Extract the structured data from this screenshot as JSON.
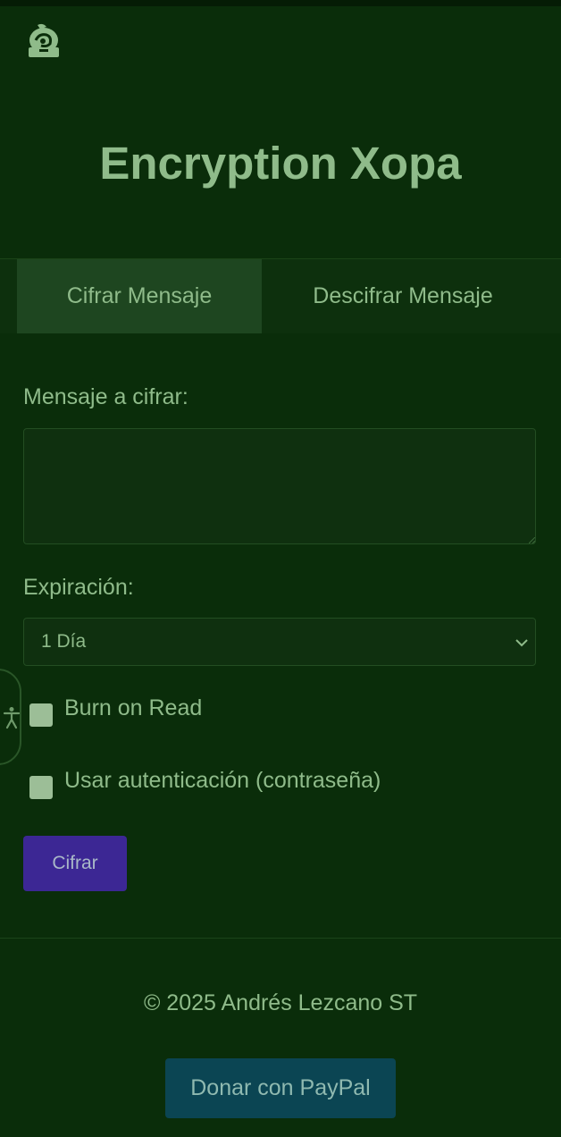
{
  "header": {
    "logo_icon": "leaf-lock-logo-icon",
    "title": "Encryption Xopa"
  },
  "tabs": [
    {
      "label": "Cifrar Mensaje",
      "active": true
    },
    {
      "label": "Descifrar Mensaje",
      "active": false
    }
  ],
  "form": {
    "message_label": "Mensaje a cifrar:",
    "message_value": "",
    "expiration_label": "Expiración:",
    "expiration_selected": "1 Día",
    "burn_on_read": {
      "label": "Burn on Read",
      "checked": false
    },
    "use_auth": {
      "label": "Usar autenticación (contraseña)",
      "checked": false
    },
    "submit_label": "Cifrar"
  },
  "accessibility": {
    "icon": "accessibility-person-icon"
  },
  "footer": {
    "copyright": "© 2025 Andrés Lezcano ST",
    "donate_label": "Donar con PayPal"
  },
  "colors": {
    "background": "#0a2d0a",
    "text": "#8fbb8a",
    "active_tab": "#1e4620",
    "submit_button": "#3c2794",
    "donate_button": "#0b4553"
  }
}
